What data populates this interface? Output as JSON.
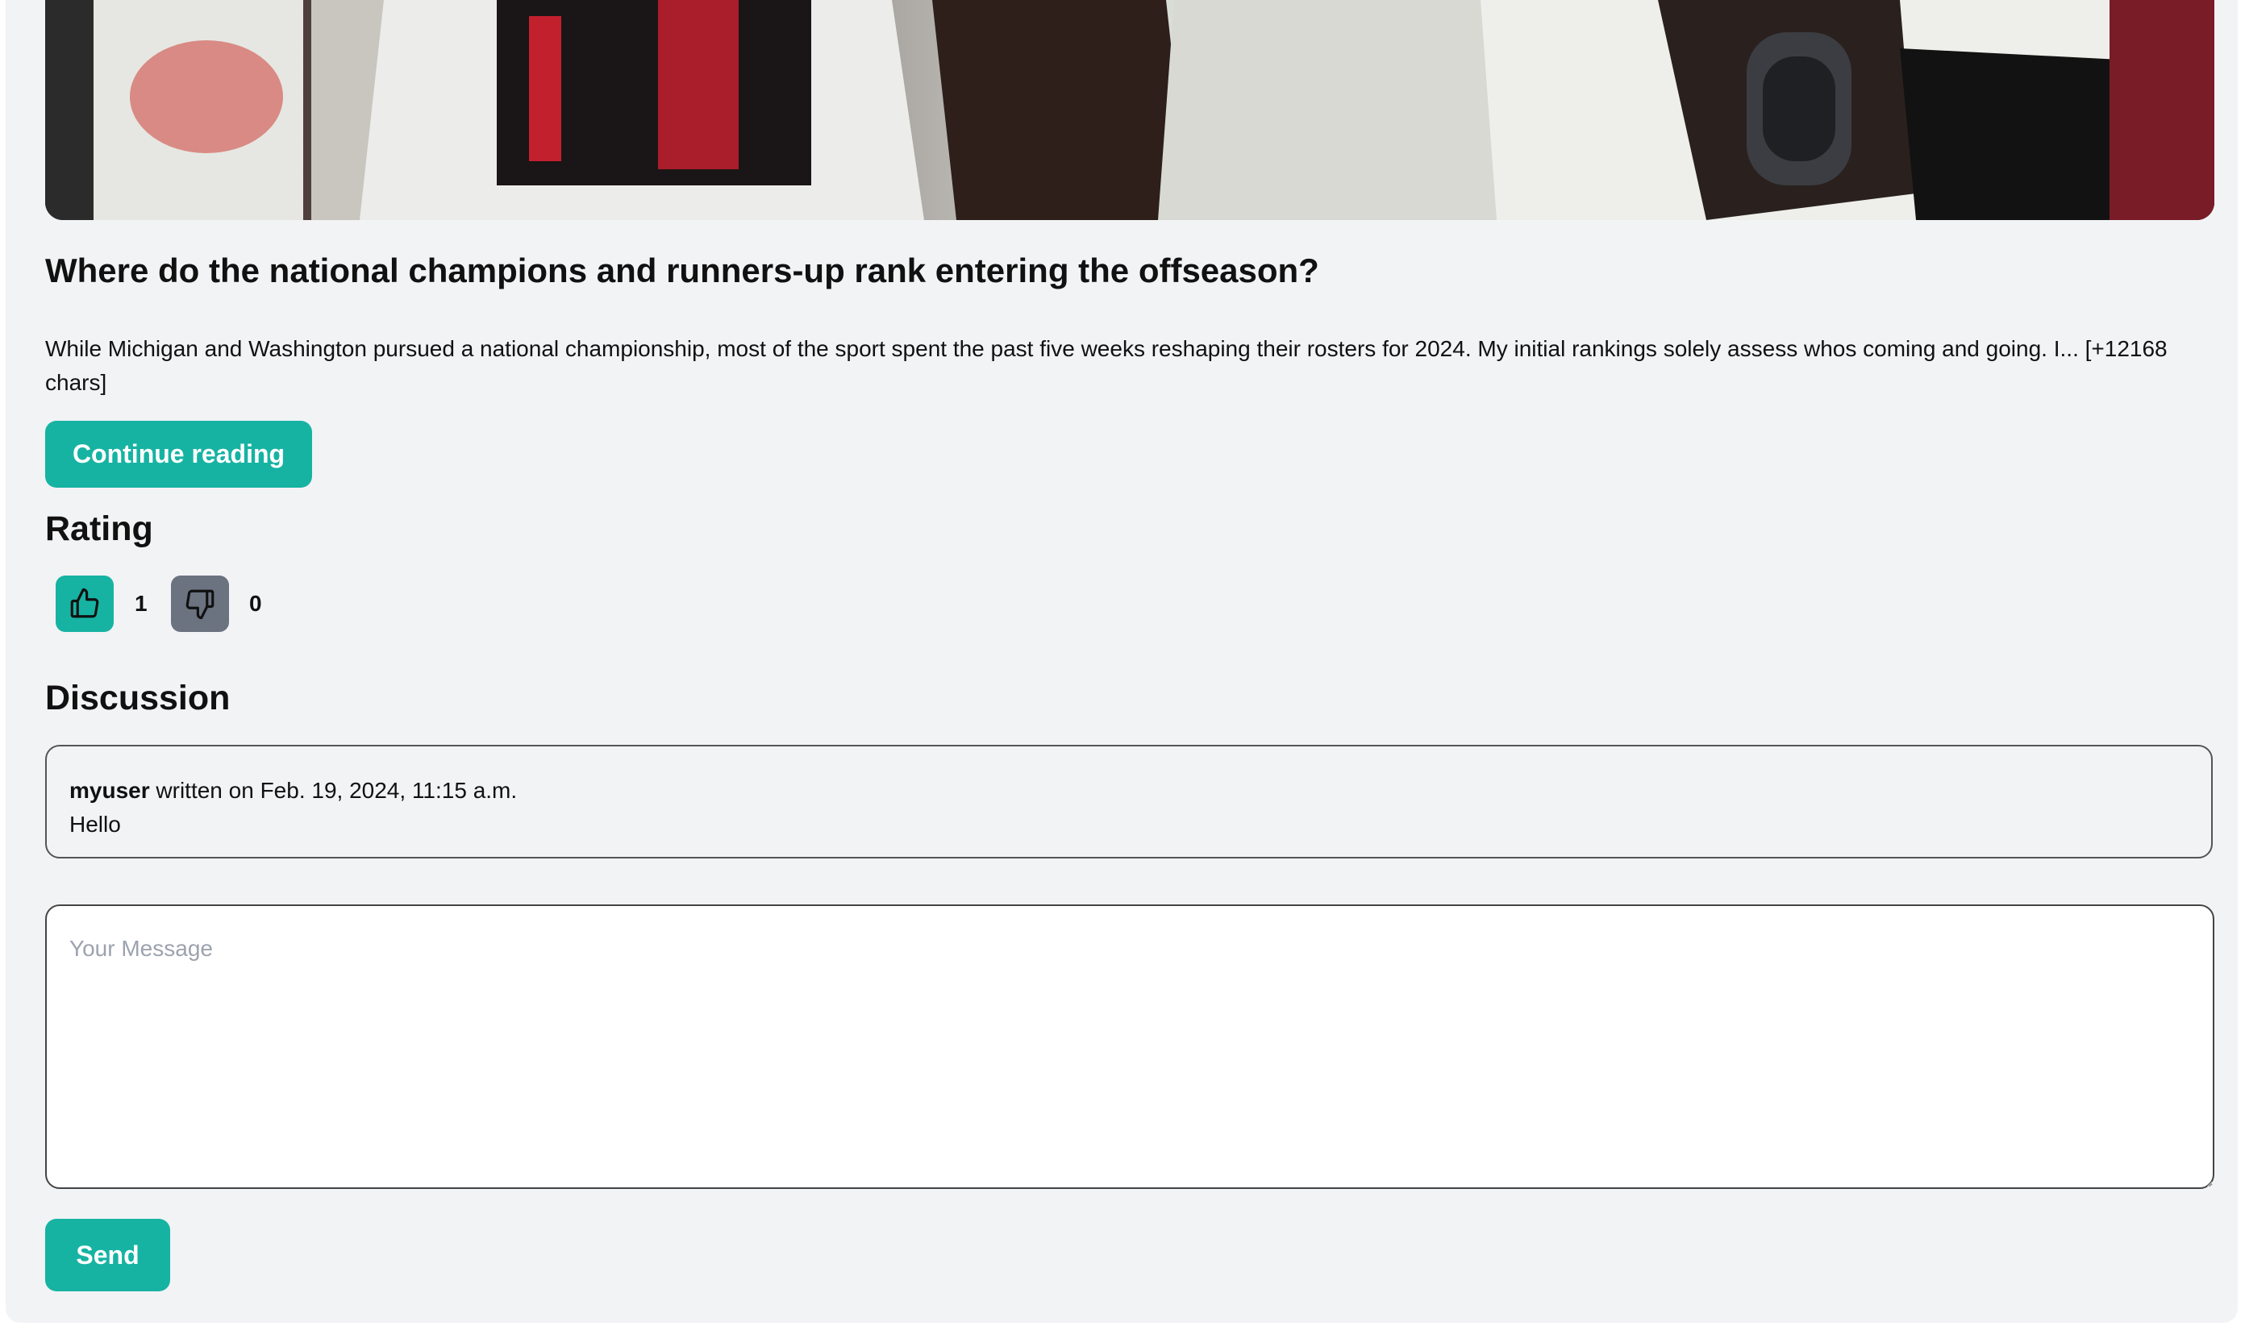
{
  "article": {
    "title": "Where do the national champions and runners-up rank entering the offseason?",
    "excerpt": "While Michigan and Washington pursued a national championship, most of the sport spent the past five weeks reshaping their rosters for 2024. My initial rankings solely assess whos coming and going. I... [+12168 chars]",
    "continue_label": "Continue reading"
  },
  "rating": {
    "heading": "Rating",
    "likes": "1",
    "dislikes": "0"
  },
  "discussion": {
    "heading": "Discussion",
    "comments": [
      {
        "author": "myuser",
        "meta": " written on Feb. 19, 2024, 11:15 a.m.",
        "body": "Hello"
      }
    ],
    "message_placeholder": "Your Message",
    "send_label": "Send"
  },
  "colors": {
    "accent": "#16b3a3",
    "dislike_button": "#6b7280",
    "card_background": "#f2f3f5"
  },
  "icons": {
    "like": "thumbs-up-icon",
    "dislike": "thumbs-down-icon"
  }
}
